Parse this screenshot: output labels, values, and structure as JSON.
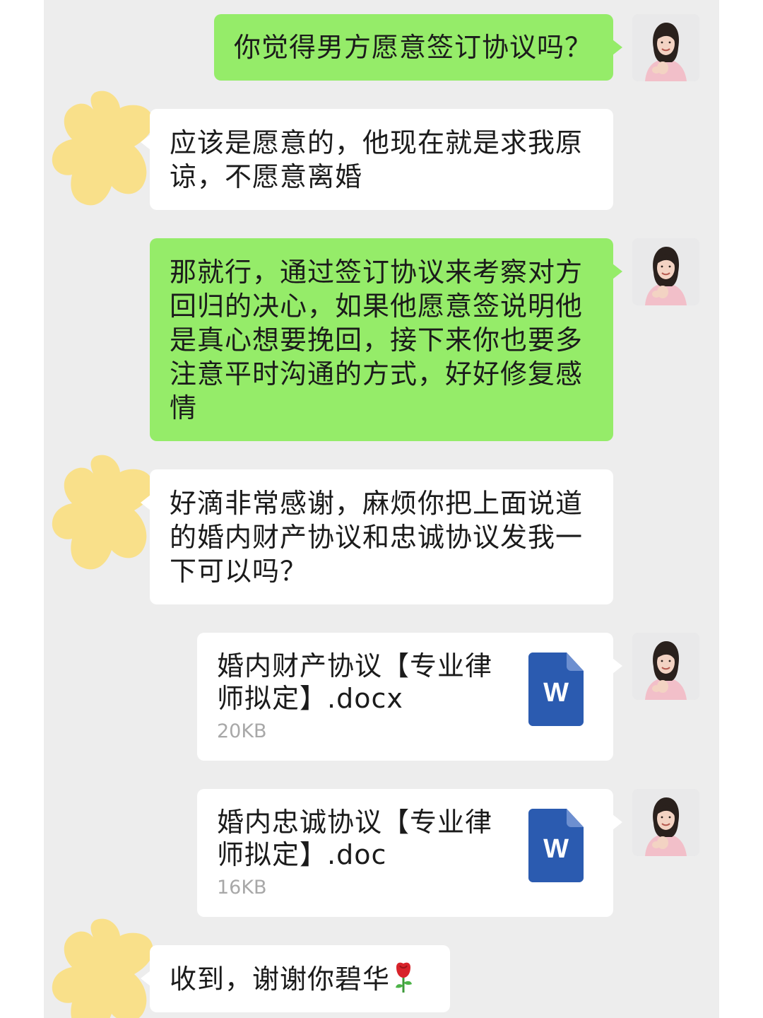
{
  "messages": [
    {
      "sender": "me",
      "type": "text",
      "text": "你觉得男方愿意签订协议吗？"
    },
    {
      "sender": "other",
      "type": "text",
      "lines": [
        "应该是愿意的，他现在就是求我原",
        "谅，不愿意离婚"
      ]
    },
    {
      "sender": "me",
      "type": "text",
      "lines": [
        "那就行，通过签订协议来考察对方",
        "回归的决心，如果他愿意签说明他",
        "是真心想要挽回，接下来你也要多",
        "注意平时沟通的方式，好好修复感",
        "情"
      ]
    },
    {
      "sender": "other",
      "type": "text",
      "lines": [
        "好滴非常感谢，麻烦你把上面说道",
        "的婚内财产协议和忠诚协议发我一",
        "下可以吗？"
      ]
    },
    {
      "sender": "me",
      "type": "file",
      "name_lines": [
        "婚内财产协议【专业律",
        "师拟定】.docx"
      ],
      "size": "20KB",
      "icon": "word-doc-icon",
      "icon_letter": "W"
    },
    {
      "sender": "me",
      "type": "file",
      "name_lines": [
        "婚内忠诚协议【专业律",
        "师拟定】.doc"
      ],
      "size": "16KB",
      "icon": "word-doc-icon",
      "icon_letter": "W"
    },
    {
      "sender": "other",
      "type": "text",
      "text": "收到，谢谢你碧华",
      "emoji": "rose-icon"
    }
  ],
  "colors": {
    "chat_background": "#ededed",
    "my_bubble": "#95ec69",
    "other_bubble": "#ffffff",
    "word_icon": "#2b5bb0",
    "redaction_blob": "#f9e08a"
  }
}
